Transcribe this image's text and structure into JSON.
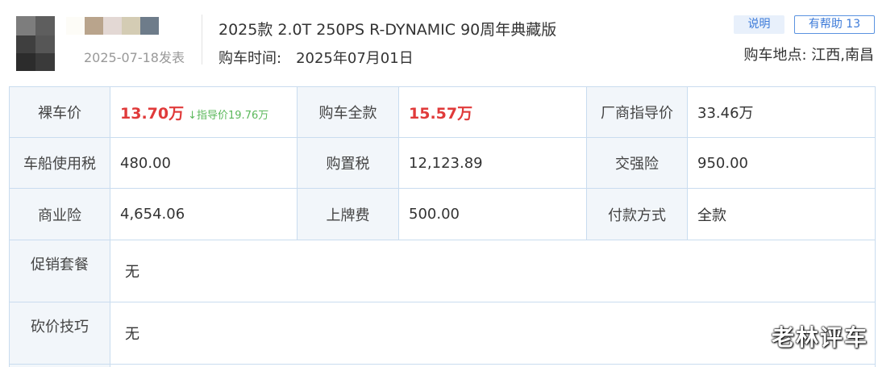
{
  "header": {
    "post_date": "2025-07-18发表",
    "model_title": "2025款 2.0T 250PS R-DYNAMIC 90周年典藏版",
    "buy_time_label": "购车时间:",
    "buy_time_value": "2025年07月01日",
    "explain_badge": "说明",
    "helpful_button": "有帮助 13",
    "location": "购车地点: 江西,南昌"
  },
  "price_table": {
    "rows": [
      [
        {
          "label": "裸车价",
          "value": "13.70万",
          "highlight": true,
          "guide_arrow": "↓",
          "guide_text": "指导价19.76万"
        },
        {
          "label": "购车全款",
          "value": "15.57万",
          "highlight": true
        },
        {
          "label": "厂商指导价",
          "value": "33.46万"
        }
      ],
      [
        {
          "label": "车船使用税",
          "value": "480.00"
        },
        {
          "label": "购置税",
          "value": "12,123.89"
        },
        {
          "label": "交强险",
          "value": "950.00"
        }
      ],
      [
        {
          "label": "商业险",
          "value": "4,654.06"
        },
        {
          "label": "上牌费",
          "value": "500.00"
        },
        {
          "label": "付款方式",
          "value": "全款"
        }
      ]
    ],
    "promo_label": "促销套餐",
    "promo_value": "无",
    "bargain_label": "砍价技巧",
    "bargain_value": "无"
  },
  "watermark": "老林评车",
  "colors": {
    "price_red": "#e03a3a",
    "guide_green": "#5cb85c",
    "link_blue": "#3d7bd9",
    "border_blue": "#c9dcef",
    "label_bg": "#f2f6fa"
  }
}
